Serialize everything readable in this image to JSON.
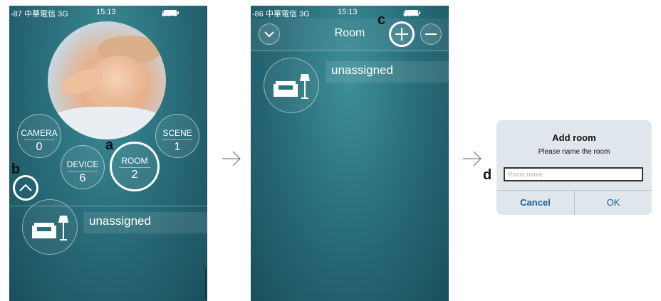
{
  "phone1": {
    "status": {
      "carrier": "-87 中華電信 3G",
      "time": "15:13",
      "battery": "80%"
    },
    "buttons": {
      "camera": {
        "label": "CAMERA",
        "count": "0"
      },
      "device": {
        "label": "DEVICE",
        "count": "6"
      },
      "room": {
        "label": "ROOM",
        "count": "2"
      },
      "scene": {
        "label": "SCENE",
        "count": "1"
      }
    },
    "markers": {
      "a": "a",
      "b": "b"
    },
    "room_name": "unassigned",
    "icons": {
      "expand": "chevron-up-icon",
      "room": "sofa-lamp-icon"
    }
  },
  "phone2": {
    "status": {
      "carrier": "-86 中華電信 3G",
      "time": "15:13",
      "battery": "80%"
    },
    "title": "Room",
    "marker": "c",
    "room_name": "unassigned",
    "icons": {
      "collapse": "chevron-down-icon",
      "add": "plus-icon",
      "remove": "minus-icon",
      "room": "sofa-lamp-icon"
    }
  },
  "dialog": {
    "title": "Add room",
    "message": "Please name the room",
    "input_placeholder": "Room name",
    "cancel": "Cancel",
    "ok": "OK",
    "marker": "d"
  },
  "colors": {
    "accent": "#1f5f9a",
    "panel": "#2a6f7b"
  }
}
